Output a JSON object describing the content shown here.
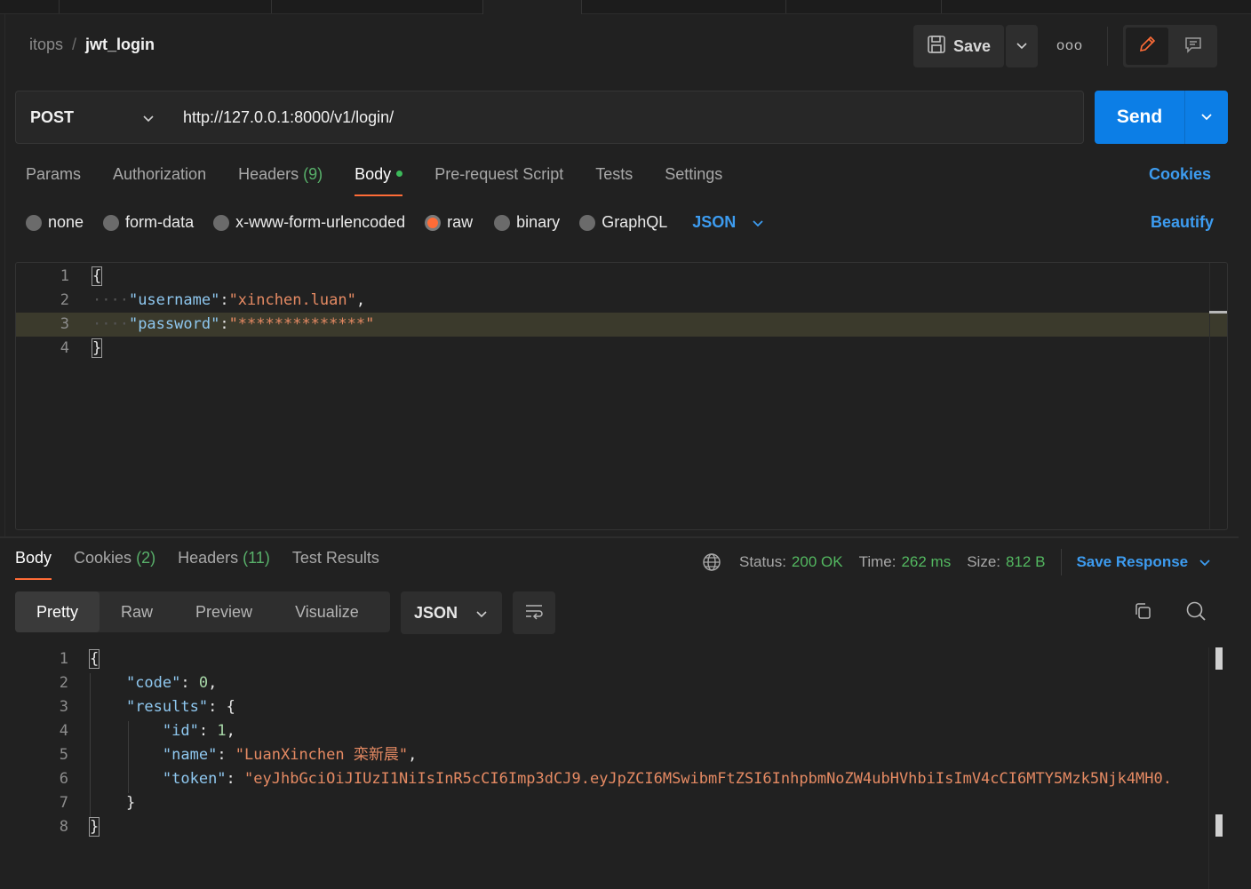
{
  "breadcrumb": {
    "parent": "itops",
    "separator": "/",
    "current": "jwt_login"
  },
  "header": {
    "save_label": "Save",
    "more_label": "ooo"
  },
  "request": {
    "method": "POST",
    "url": "http://127.0.0.1:8000/v1/login/",
    "send_label": "Send"
  },
  "request_tabs": [
    {
      "label": "Params",
      "count": ""
    },
    {
      "label": "Authorization",
      "count": ""
    },
    {
      "label": "Headers",
      "count": "(9)"
    },
    {
      "label": "Body",
      "count": "",
      "active": true,
      "indicator": "green-dot"
    },
    {
      "label": "Pre-request Script",
      "count": ""
    },
    {
      "label": "Tests",
      "count": ""
    },
    {
      "label": "Settings",
      "count": ""
    }
  ],
  "cookies_link": "Cookies",
  "body_types": [
    {
      "label": "none",
      "selected": false
    },
    {
      "label": "form-data",
      "selected": false
    },
    {
      "label": "x-www-form-urlencoded",
      "selected": false
    },
    {
      "label": "raw",
      "selected": true
    },
    {
      "label": "binary",
      "selected": false
    },
    {
      "label": "GraphQL",
      "selected": false
    }
  ],
  "raw_format": "JSON",
  "beautify_label": "Beautify",
  "request_body": {
    "line_numbers": [
      "1",
      "2",
      "3",
      "4"
    ],
    "open_brace": "{",
    "close_brace": "}",
    "whitespace": "····",
    "fields": [
      {
        "key": "\"username\"",
        "colon": ":",
        "value": "\"xinchen.luan\"",
        "comma": ","
      },
      {
        "key": "\"password\"",
        "colon": ":",
        "value": "\"**************\"",
        "comma": ""
      }
    ]
  },
  "response_tabs": [
    {
      "label": "Body",
      "count": "",
      "active": true
    },
    {
      "label": "Cookies",
      "count": "(2)"
    },
    {
      "label": "Headers",
      "count": "(11)"
    },
    {
      "label": "Test Results",
      "count": ""
    }
  ],
  "response_meta": {
    "status_label": "Status:",
    "status_value": "200 OK",
    "time_label": "Time:",
    "time_value": "262 ms",
    "size_label": "Size:",
    "size_value": "812 B",
    "save_response_label": "Save Response"
  },
  "view_modes": [
    {
      "label": "Pretty",
      "active": true
    },
    {
      "label": "Raw",
      "active": false
    },
    {
      "label": "Preview",
      "active": false
    },
    {
      "label": "Visualize",
      "active": false
    }
  ],
  "response_format": "JSON",
  "response_body": {
    "line_numbers": [
      "1",
      "2",
      "3",
      "4",
      "5",
      "6",
      "7",
      "8"
    ],
    "open_brace": "{",
    "close_brace": "}",
    "code_key": "\"code\"",
    "code_value": "0",
    "results_key": "\"results\"",
    "results_open": "{",
    "results_close": "}",
    "id_key": "\"id\"",
    "id_value": "1",
    "name_key": "\"name\"",
    "name_value": "\"LuanXinchen 栾新晨\"",
    "token_key": "\"token\"",
    "token_value": "\"eyJhbGciOiJIUzI1NiIsInR5cCI6Imp3dCJ9.eyJpZCI6MSwibmFtZSI6InhpbmNoZW4ubHVhbiIsImV4cCI6MTY5Mzk5Njk4MH0."
  },
  "colors": {
    "accent_orange": "#ff6c37",
    "link_blue": "#3d9cf0",
    "send_blue": "#0c7ee6",
    "success_green": "#53b860",
    "background": "#212121"
  }
}
